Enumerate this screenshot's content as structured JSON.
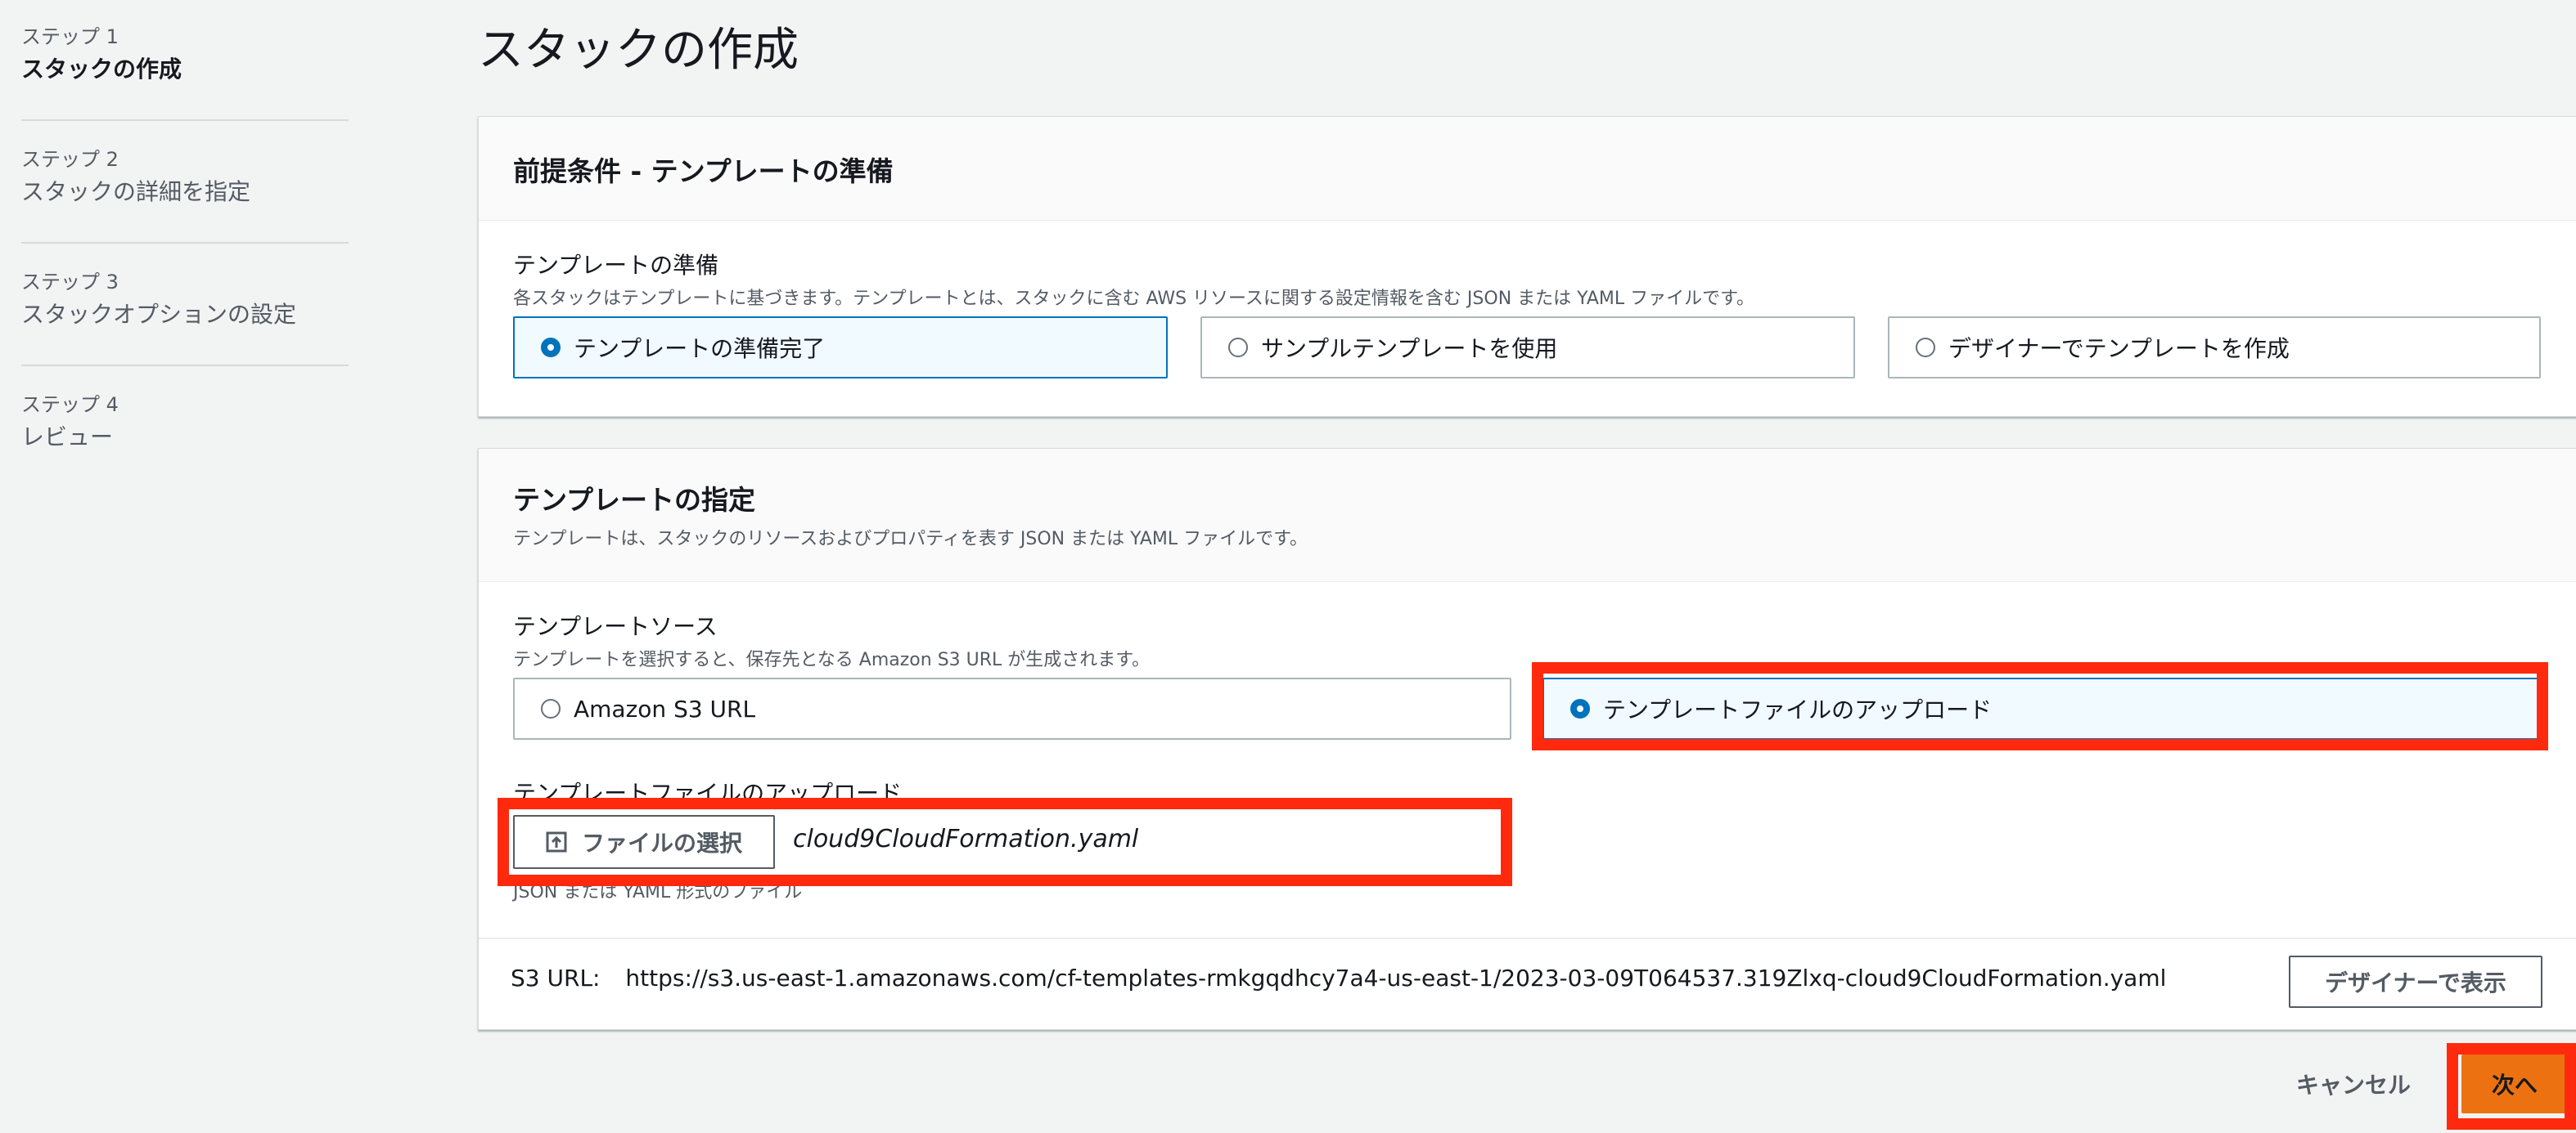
{
  "steps": [
    {
      "num": "ステップ 1",
      "label": "スタックの作成"
    },
    {
      "num": "ステップ 2",
      "label": "スタックの詳細を指定"
    },
    {
      "num": "ステップ 3",
      "label": "スタックオプションの設定"
    },
    {
      "num": "ステップ 4",
      "label": "レビュー"
    }
  ],
  "page_title": "スタックの作成",
  "prereq": {
    "title": "前提条件 - テンプレートの準備",
    "field_label": "テンプレートの準備",
    "field_desc": "各スタックはテンプレートに基づきます。テンプレートとは、スタックに含む AWS リソースに関する設定情報を含む JSON または YAML ファイルです。",
    "options": [
      "テンプレートの準備完了",
      "サンプルテンプレートを使用",
      "デザイナーでテンプレートを作成"
    ],
    "selected": "テンプレートの準備完了"
  },
  "spec": {
    "title": "テンプレートの指定",
    "desc": "テンプレートは、スタックのリソースおよびプロパティを表す JSON または YAML ファイルです。",
    "source_label": "テンプレートソース",
    "source_desc": "テンプレートを選択すると、保存先となる Amazon S3 URL が生成されます。",
    "source_options": [
      "Amazon S3 URL",
      "テンプレートファイルのアップロード"
    ],
    "source_selected": "テンプレートファイルのアップロード",
    "upload_label": "テンプレートファイルのアップロード",
    "choose_file_label": "ファイルの選択",
    "file_name": "cloud9CloudFormation.yaml",
    "file_hint": "JSON または YAML 形式のファイル",
    "s3_url_label": "S3 URL:",
    "s3_url_value": "https://s3.us-east-1.amazonaws.com/cf-templates-rmkgqdhcy7a4-us-east-1/2023-03-09T064537.319Zlxq-cloud9CloudFormation.yaml",
    "view_in_designer_label": "デザイナーで表示"
  },
  "footer": {
    "cancel_label": "キャンセル",
    "next_label": "次へ"
  },
  "colors": {
    "accent": "#0073bb",
    "primary_button": "#ec7211",
    "highlight_box": "#ff2a0d"
  }
}
